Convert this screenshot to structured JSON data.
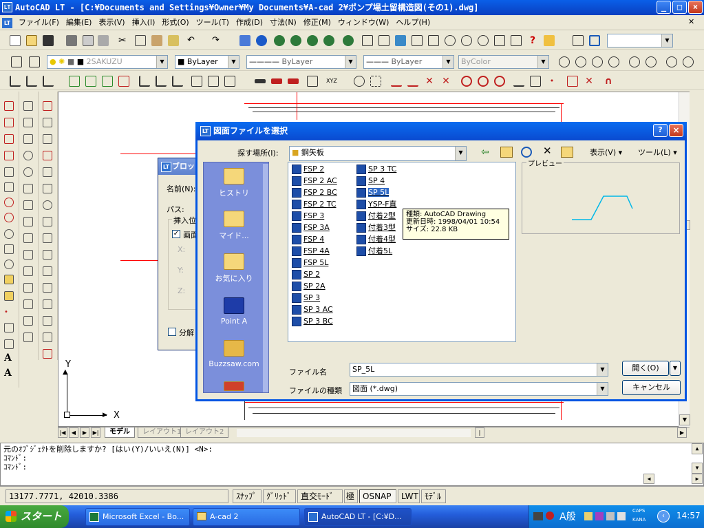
{
  "window": {
    "title": "AutoCAD LT - [C:¥Documents and Settings¥Owner¥My Documents¥A-cad 2¥ポンプ場土留構造図(その1).dwg]",
    "icon": "LT"
  },
  "menu": [
    "ファイル(F)",
    "編集(E)",
    "表示(V)",
    "挿入(I)",
    "形式(O)",
    "ツール(T)",
    "作成(D)",
    "寸法(N)",
    "修正(M)",
    "ウィンドウ(W)",
    "ヘルプ(H)"
  ],
  "layer_toolbar": {
    "layer_name": "2SAKUZU",
    "color": "ByLayer",
    "linetype": "ByLayer",
    "lineweight": "ByLayer",
    "plotstyle": "ByColor"
  },
  "block_dialog": {
    "title": "ブロッ",
    "name_label": "名前(N):",
    "path_label": "パス:",
    "insert_label": "挿入位",
    "onscreen": "画面",
    "x": "X:",
    "y": "Y:",
    "z": "Z:",
    "explode": "分解"
  },
  "file_dialog": {
    "title": "図面ファイルを選択",
    "lookin_label": "探す場所(I):",
    "lookin_value": "鋼矢板",
    "view_label": "表示(V)",
    "tools_label": "ツール(L)",
    "preview_label": "プレビュー",
    "places": [
      "ヒストリ",
      "マイド...",
      "お気に入り",
      "Point A",
      "Buzzsaw.com"
    ],
    "files_col1": [
      "FSP 2",
      "FSP 2 AC",
      "FSP 2 BC",
      "FSP 2 TC",
      "FSP 3",
      "FSP 3A",
      "FSP 4",
      "FSP 4A",
      "FSP 5L",
      "SP 2",
      "SP 2A",
      "SP 3",
      "SP 3 AC",
      "SP 3 BC"
    ],
    "files_col2": [
      "SP 3 TC",
      "SP 4",
      "SP 5L",
      "YSP-F直",
      "付着2型",
      "付着3型",
      "付着4型",
      "付着5L"
    ],
    "selected_file": "SP 5L",
    "tooltip": {
      "type": "種類: AutoCAD Drawing",
      "modified": "更新日時: 1998/04/01 10:54",
      "size": "サイズ: 22.8 KB"
    },
    "filename_label": "ファイル名",
    "filename_value": "SP_5L",
    "filetype_label": "ファイルの種類",
    "filetype_value": "図面 (*.dwg)",
    "open_button": "開く(O)",
    "cancel_button": "キャンセル"
  },
  "axis": {
    "y": "Y",
    "x": "X"
  },
  "tabs": [
    "モデル",
    "レイアウト1",
    "レイアウト2"
  ],
  "command_lines": [
    "元のｵﾌﾞｼﾞｪｸﾄを削除しますか? [はい(Y)/いいえ(N)] <N>:",
    "ｺﾏﾝﾄﾞ:",
    "ｺﾏﾝﾄﾞ:"
  ],
  "status": {
    "coords": "13177.7771, 42010.3386",
    "buttons": [
      "ｽﾅｯﾌﾟ",
      "ｸﾞﾘｯﾄﾞ",
      "直交ﾓｰﾄﾞ",
      "極",
      "OSNAP",
      "LWT",
      "ﾓﾃﾞﾙ"
    ]
  },
  "taskbar": {
    "start": "スタート",
    "tasks": [
      "Microsoft Excel - Bo...",
      "A-cad 2",
      "AutoCAD LT - [C:¥D..."
    ],
    "ime": "A般",
    "caps": "CAPS",
    "kana": "KANA",
    "clock": "14:57"
  },
  "colors": {
    "title_blue": "#0A4AD0",
    "drawing_red": "#FF0000",
    "selection_blue": "#316AC5",
    "preview_curve": "#00B8E8"
  }
}
